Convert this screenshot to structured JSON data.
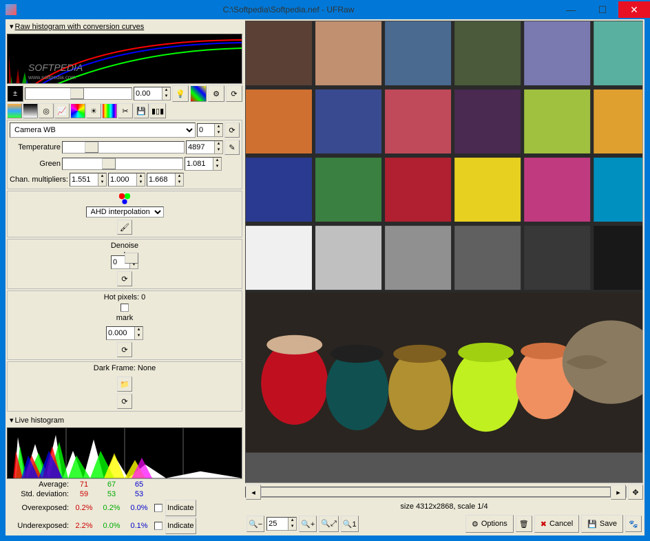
{
  "window": {
    "title": "C:\\Softpedia\\Softpedia.nef - UFRaw"
  },
  "histogram": {
    "raw_title": "Raw histogram with conversion curves",
    "live_title": "Live histogram",
    "watermark": "SOFTPEDIA",
    "watermark_url": "www.softpedia.com"
  },
  "exposure": {
    "value": "0.00"
  },
  "whitebalance": {
    "preset": "Camera WB",
    "preset_spin": "0",
    "temp_label": "Temperature",
    "temperature": "4897",
    "green_label": "Green",
    "green": "1.081",
    "chan_label": "Chan. multipliers:",
    "ch1": "1.551",
    "ch2": "1.000",
    "ch3": "1.668"
  },
  "interpolation": {
    "method": "AHD interpolation"
  },
  "denoise": {
    "label": "Denoise",
    "value": "0"
  },
  "hotpixels": {
    "label": "Hot pixels: 0",
    "mark_label": "mark",
    "value": "0.000"
  },
  "darkframe": {
    "label": "Dark Frame:  None"
  },
  "stats": {
    "avg_label": "Average:",
    "avg": {
      "r": "71",
      "g": "67",
      "b": "65"
    },
    "std_label": "Std. deviation:",
    "std": {
      "r": "59",
      "g": "53",
      "b": "53"
    },
    "over_label": "Overexposed:",
    "over": {
      "r": "0.2%",
      "g": "0.2%",
      "b": "0.0%"
    },
    "under_label": "Underexposed:",
    "under": {
      "r": "2.2%",
      "g": "0.0%",
      "b": "0.1%"
    },
    "indicate": "Indicate"
  },
  "status": {
    "size": "size 4312x2868, scale 1/4"
  },
  "zoom": {
    "value": "25"
  },
  "buttons": {
    "options": "Options",
    "cancel": "Cancel",
    "save": "Save"
  }
}
